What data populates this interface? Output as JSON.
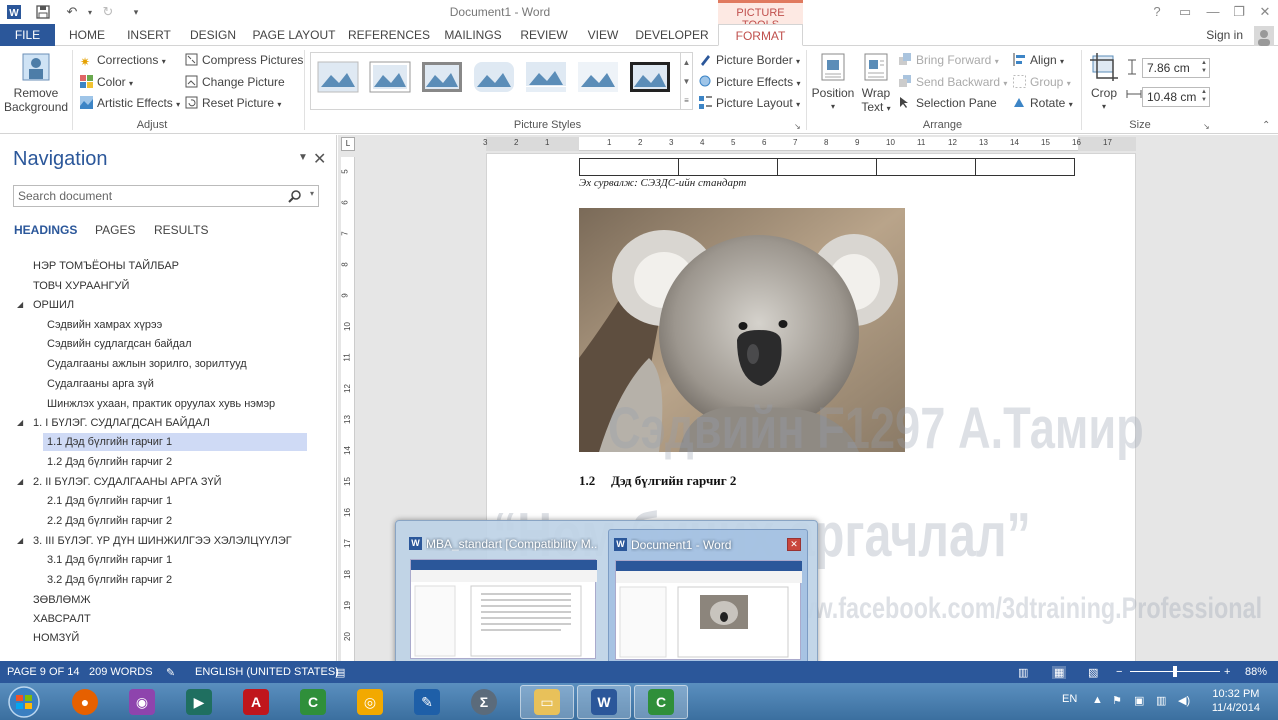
{
  "window": {
    "doc_title": "Document1 - Word",
    "contextual_tab_group": "PICTURE TOOLS",
    "help": "?",
    "controls": [
      "▭",
      "—",
      "❐",
      "✕"
    ]
  },
  "tabs": [
    "FILE",
    "HOME",
    "INSERT",
    "DESIGN",
    "PAGE LAYOUT",
    "REFERENCES",
    "MAILINGS",
    "REVIEW",
    "VIEW",
    "DEVELOPER",
    "FORMAT"
  ],
  "signin": "Sign in",
  "ribbon": {
    "remove_bg_line1": "Remove",
    "remove_bg_line2": "Background",
    "adjust": {
      "corrections": "Corrections",
      "color": "Color",
      "artistic": "Artistic Effects",
      "compress": "Compress Pictures",
      "change": "Change Picture",
      "reset": "Reset Picture",
      "label": "Adjust"
    },
    "styles": {
      "label": "Picture Styles",
      "border": "Picture Border",
      "effects": "Picture Effects",
      "layout": "Picture Layout"
    },
    "arrange": {
      "position": "Position",
      "wrap_line1": "Wrap",
      "wrap_line2": "Text",
      "bring_forward": "Bring Forward",
      "send_backward": "Send Backward",
      "selection_pane": "Selection Pane",
      "align": "Align",
      "group": "Group",
      "rotate": "Rotate",
      "label": "Arrange"
    },
    "size": {
      "crop": "Crop",
      "height": "7.86 cm",
      "width": "10.48 cm",
      "label": "Size"
    }
  },
  "nav": {
    "title": "Navigation",
    "search_placeholder": "Search document",
    "tabs": [
      "HEADINGS",
      "PAGES",
      "RESULTS"
    ],
    "headings": [
      {
        "text": "НЭР ТОМЪЁОНЫ ТАЙЛБАР",
        "level": 1
      },
      {
        "text": "ТОВЧ ХУРААНГУЙ",
        "level": 1
      },
      {
        "text": "ОРШИЛ",
        "level": 1,
        "expanded": true
      },
      {
        "text": "Сэдвийн хамрах хүрээ",
        "level": 2
      },
      {
        "text": "Сэдвийн судлагдсан байдал",
        "level": 2
      },
      {
        "text": "Судалгааны ажлын зорилго, зорилтууд",
        "level": 2
      },
      {
        "text": "Судалгааны арга зүй",
        "level": 2
      },
      {
        "text": "Шинжлэх ухаан, практик оруулах хувь нэмэр",
        "level": 2
      },
      {
        "text": "1. I БҮЛЭГ. СУДЛАГДСАН БАЙДАЛ",
        "level": 1,
        "expanded": true
      },
      {
        "text": "1.1 Дэд бүлгийн гарчиг 1",
        "level": 2,
        "selected": true
      },
      {
        "text": "1.2 Дэд бүлгийн гарчиг 2",
        "level": 2
      },
      {
        "text": "2. II БҮЛЭГ. СУДАЛГААНЫ АРГА ЗҮЙ",
        "level": 1,
        "expanded": true
      },
      {
        "text": "2.1 Дэд бүлгийн гарчиг 1",
        "level": 2
      },
      {
        "text": "2.2 Дэд бүлгийн гарчиг 2",
        "level": 2
      },
      {
        "text": "3. III БҮЛЭГ. ҮР ДҮН ШИНЖИЛГЭЭ ХЭЛЭЛЦҮҮЛЭГ",
        "level": 1,
        "expanded": true
      },
      {
        "text": "3.1 Дэд бүлгийн гарчиг 1",
        "level": 2
      },
      {
        "text": "3.2 Дэд бүлгийн гарчиг 2",
        "level": 2
      },
      {
        "text": "ЗӨВЛӨМЖ",
        "level": 1
      },
      {
        "text": "ХАВСРАЛТ",
        "level": 1
      },
      {
        "text": "НОМЗҮЙ",
        "level": 1
      }
    ]
  },
  "ruler": {
    "h_ticks": [
      "3",
      "2",
      "1",
      "",
      "1",
      "2",
      "3",
      "4",
      "5",
      "6",
      "7",
      "8",
      "9",
      "10",
      "11",
      "12",
      "13",
      "14",
      "15",
      "16",
      "17"
    ],
    "v_ticks": [
      "5",
      "6",
      "7",
      "8",
      "9",
      "10",
      "11",
      "12",
      "13",
      "14",
      "15",
      "16",
      "17",
      "18",
      "19",
      "20"
    ],
    "corner": "L"
  },
  "document": {
    "source_caption": "Эх сурвалж: СЭЗДС-ийн стандарт",
    "heading_num": "1.2",
    "heading_text": "Дэд бүлгийн гарчиг 2"
  },
  "watermark": {
    "line1": "Сэдвийн F1297 А.Тамир",
    "line2": "“Ном  бичих аргачлал”",
    "line3": "https://www.facebook.com/3dtraining.Professional"
  },
  "thumbnails": [
    {
      "title": "MBA_standart [Compatibility M..."
    },
    {
      "title": "Document1 - Word"
    }
  ],
  "status": {
    "page": "PAGE 9 OF 14",
    "words": "209 WORDS",
    "language": "ENGLISH (UNITED STATES)",
    "zoom": "88%",
    "zoom_minus": "−",
    "zoom_plus": "+",
    "zoom_level": 0.5
  },
  "taskbar": {
    "lang": "EN",
    "time": "10:32 PM",
    "date": "11/4/2014"
  },
  "colors": {
    "word_blue": "#2b579a",
    "picture_tools": "#c0504d"
  }
}
